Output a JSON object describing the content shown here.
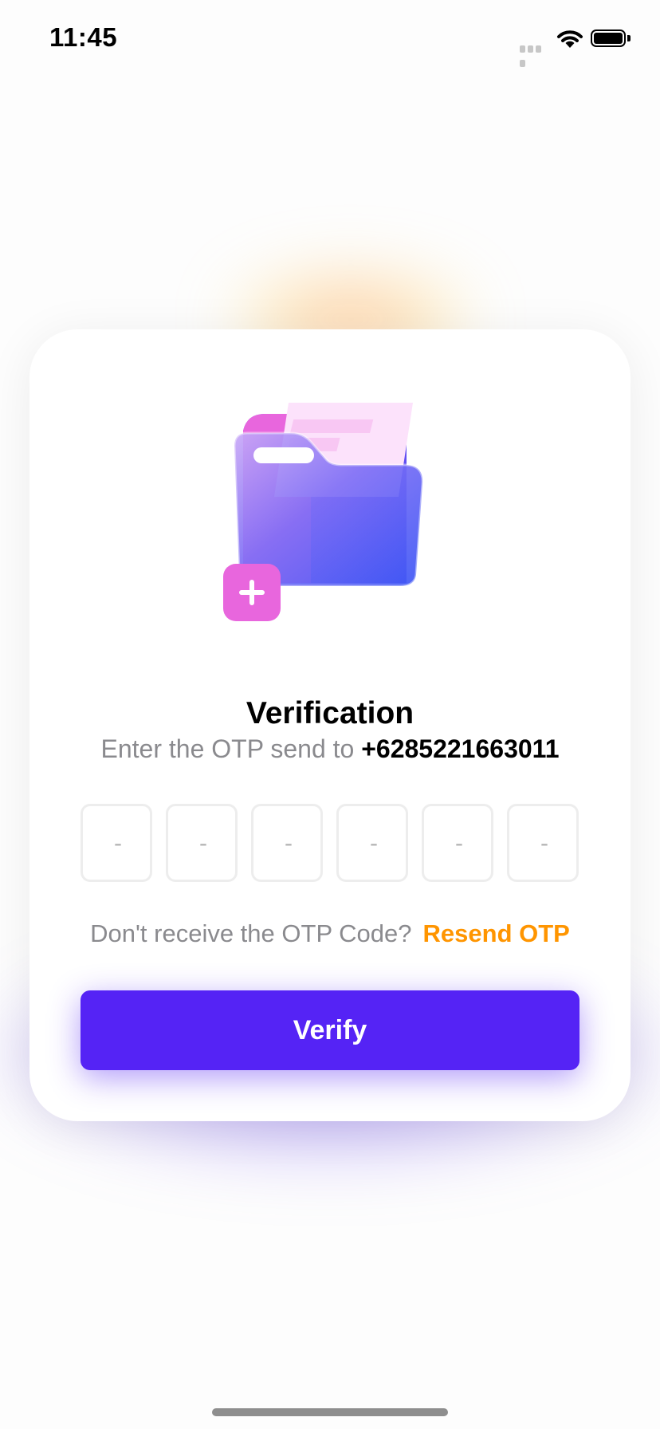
{
  "status_bar": {
    "time": "11:45"
  },
  "illustration": {
    "name": "folder-add-illustration",
    "colors": {
      "folder_front": "#3f55f5",
      "folder_back": "#5b4cf2",
      "accent_pink": "#e866dd",
      "paper": "#fbd9f8"
    }
  },
  "verification": {
    "title": "Verification",
    "subtitle_prefix": "Enter the OTP send to ",
    "phone_number": "+6285221663011",
    "otp_placeholder": "-",
    "otp_digit_count": 6,
    "resend_question": "Don't receive the OTP Code?",
    "resend_label": "Resend OTP",
    "verify_label": "Verify"
  },
  "colors": {
    "primary": "#5523f5",
    "resend": "#ff9500",
    "secondary_text": "#8a8a8e",
    "otp_border": "#ededed"
  }
}
